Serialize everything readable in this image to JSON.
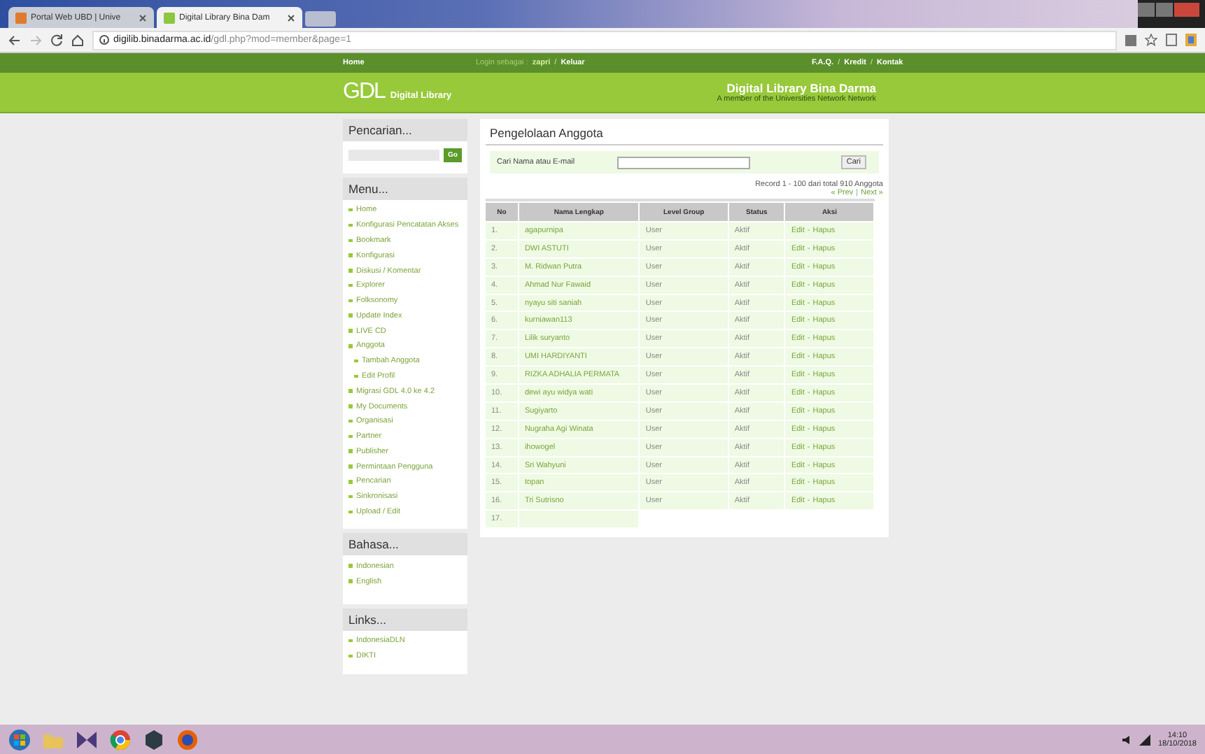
{
  "browser": {
    "tabs": [
      {
        "title": "Portal Web UBD | Unive",
        "selected": false
      },
      {
        "title": "Digital Library Bina Dam",
        "selected": true
      }
    ],
    "url": {
      "host": "digilib.binadarma.ac.id",
      "path": "/gdl.php?mod=member&page=1"
    }
  },
  "site": {
    "nav": {
      "home": "Home",
      "login_label": "Login sebagai :",
      "user": "zapri",
      "sep": "/",
      "logout": "Keluar",
      "links": [
        "F.A.Q.",
        "Kredit",
        "Kontak"
      ]
    },
    "logo": "GDL",
    "logo_sub": "Digital Library",
    "title": "Digital Library Bina Darma",
    "subtitle": "A member of the Universities Network Network"
  },
  "sidebar": {
    "search": {
      "title": "Pencarian...",
      "button": "Go"
    },
    "menu": {
      "title": "Menu...",
      "items": [
        {
          "label": "Home"
        },
        {
          "label": "Konfigurasi Pencatatan Akses"
        },
        {
          "label": "Bookmark"
        },
        {
          "label": "Konfigurasi"
        },
        {
          "label": "Diskusi / Komentar"
        },
        {
          "label": "Explorer"
        },
        {
          "label": "Folksonomy"
        },
        {
          "label": "Update Index"
        },
        {
          "label": "LIVE CD"
        },
        {
          "label": "Anggota",
          "children": [
            {
              "label": "Tambah Anggota"
            },
            {
              "label": "Edit Profil"
            }
          ]
        },
        {
          "label": "Migrasi GDL 4.0 ke 4.2"
        },
        {
          "label": "My Documents"
        },
        {
          "label": "Organisasi"
        },
        {
          "label": "Partner"
        },
        {
          "label": "Publisher"
        },
        {
          "label": "Permintaan Pengguna"
        },
        {
          "label": "Pencarian"
        },
        {
          "label": "Sinkronisasi"
        },
        {
          "label": "Upload / Edit"
        }
      ]
    },
    "bahasa": {
      "title": "Bahasa...",
      "items": [
        {
          "label": "Indonesian"
        },
        {
          "label": "English"
        }
      ]
    },
    "links": {
      "title": "Links...",
      "items": [
        {
          "label": "IndonesiaDLN"
        },
        {
          "label": "DIKTI"
        }
      ]
    }
  },
  "content": {
    "title": "Pengelolaan Anggota",
    "search_label": "Cari Nama atau E-mail",
    "search_button": "Cari",
    "record_info": "Record 1 - 100 dari total 910 Anggota",
    "pager": {
      "prev": "« Prev",
      "sep": "|",
      "next": "Next »"
    },
    "action_sep": "-",
    "columns": [
      "No",
      "Nama Lengkap",
      "Level Group",
      "Status",
      "Aksi"
    ],
    "rows": [
      {
        "no": "1.",
        "name": "agapurnipa",
        "level": "User",
        "status": "Aktif",
        "actions": [
          "Edit",
          "Hapus"
        ]
      },
      {
        "no": "2.",
        "name": "DWI ASTUTI",
        "level": "User",
        "status": "Aktif",
        "actions": [
          "Edit",
          "Hapus"
        ]
      },
      {
        "no": "3.",
        "name": "M. Ridwan Putra",
        "level": "User",
        "status": "Aktif",
        "actions": [
          "Edit",
          "Hapus"
        ]
      },
      {
        "no": "4.",
        "name": "Ahmad Nur Fawaid",
        "level": "User",
        "status": "Aktif",
        "actions": [
          "Edit",
          "Hapus"
        ]
      },
      {
        "no": "5.",
        "name": "nyayu siti saniah",
        "level": "User",
        "status": "Aktif",
        "actions": [
          "Edit",
          "Hapus"
        ]
      },
      {
        "no": "6.",
        "name": "kurniawan113",
        "level": "User",
        "status": "Aktif",
        "actions": [
          "Edit",
          "Hapus"
        ]
      },
      {
        "no": "7.",
        "name": "Lilik suryanto",
        "level": "User",
        "status": "Aktif",
        "actions": [
          "Edit",
          "Hapus"
        ]
      },
      {
        "no": "8.",
        "name": "UMI HARDIYANTI",
        "level": "User",
        "status": "Aktif",
        "actions": [
          "Edit",
          "Hapus"
        ]
      },
      {
        "no": "9.",
        "name": "RIZKA ADHALIA PERMATA",
        "level": "User",
        "status": "Aktif",
        "actions": [
          "Edit",
          "Hapus"
        ]
      },
      {
        "no": "10.",
        "name": "dewi ayu widya wati",
        "level": "User",
        "status": "Aktif",
        "actions": [
          "Edit",
          "Hapus"
        ]
      },
      {
        "no": "11.",
        "name": "Sugiyarto",
        "level": "User",
        "status": "Aktif",
        "actions": [
          "Edit",
          "Hapus"
        ]
      },
      {
        "no": "12.",
        "name": "Nugraha Agi Winata",
        "level": "User",
        "status": "Aktif",
        "actions": [
          "Edit",
          "Hapus"
        ]
      },
      {
        "no": "13.",
        "name": "ihowogel",
        "level": "User",
        "status": "Aktif",
        "actions": [
          "Edit",
          "Hapus"
        ]
      },
      {
        "no": "14.",
        "name": "Sri Wahyuni",
        "level": "User",
        "status": "Aktif",
        "actions": [
          "Edit",
          "Hapus"
        ]
      },
      {
        "no": "15.",
        "name": "topan",
        "level": "User",
        "status": "Aktif",
        "actions": [
          "Edit",
          "Hapus"
        ]
      },
      {
        "no": "16.",
        "name": "Tri Sutrisno",
        "level": "User",
        "status": "Aktif",
        "actions": [
          "Edit",
          "Hapus"
        ]
      },
      {
        "no": "17."
      }
    ]
  },
  "taskbar": {
    "time": "14:10",
    "date": "18/10/2018"
  }
}
